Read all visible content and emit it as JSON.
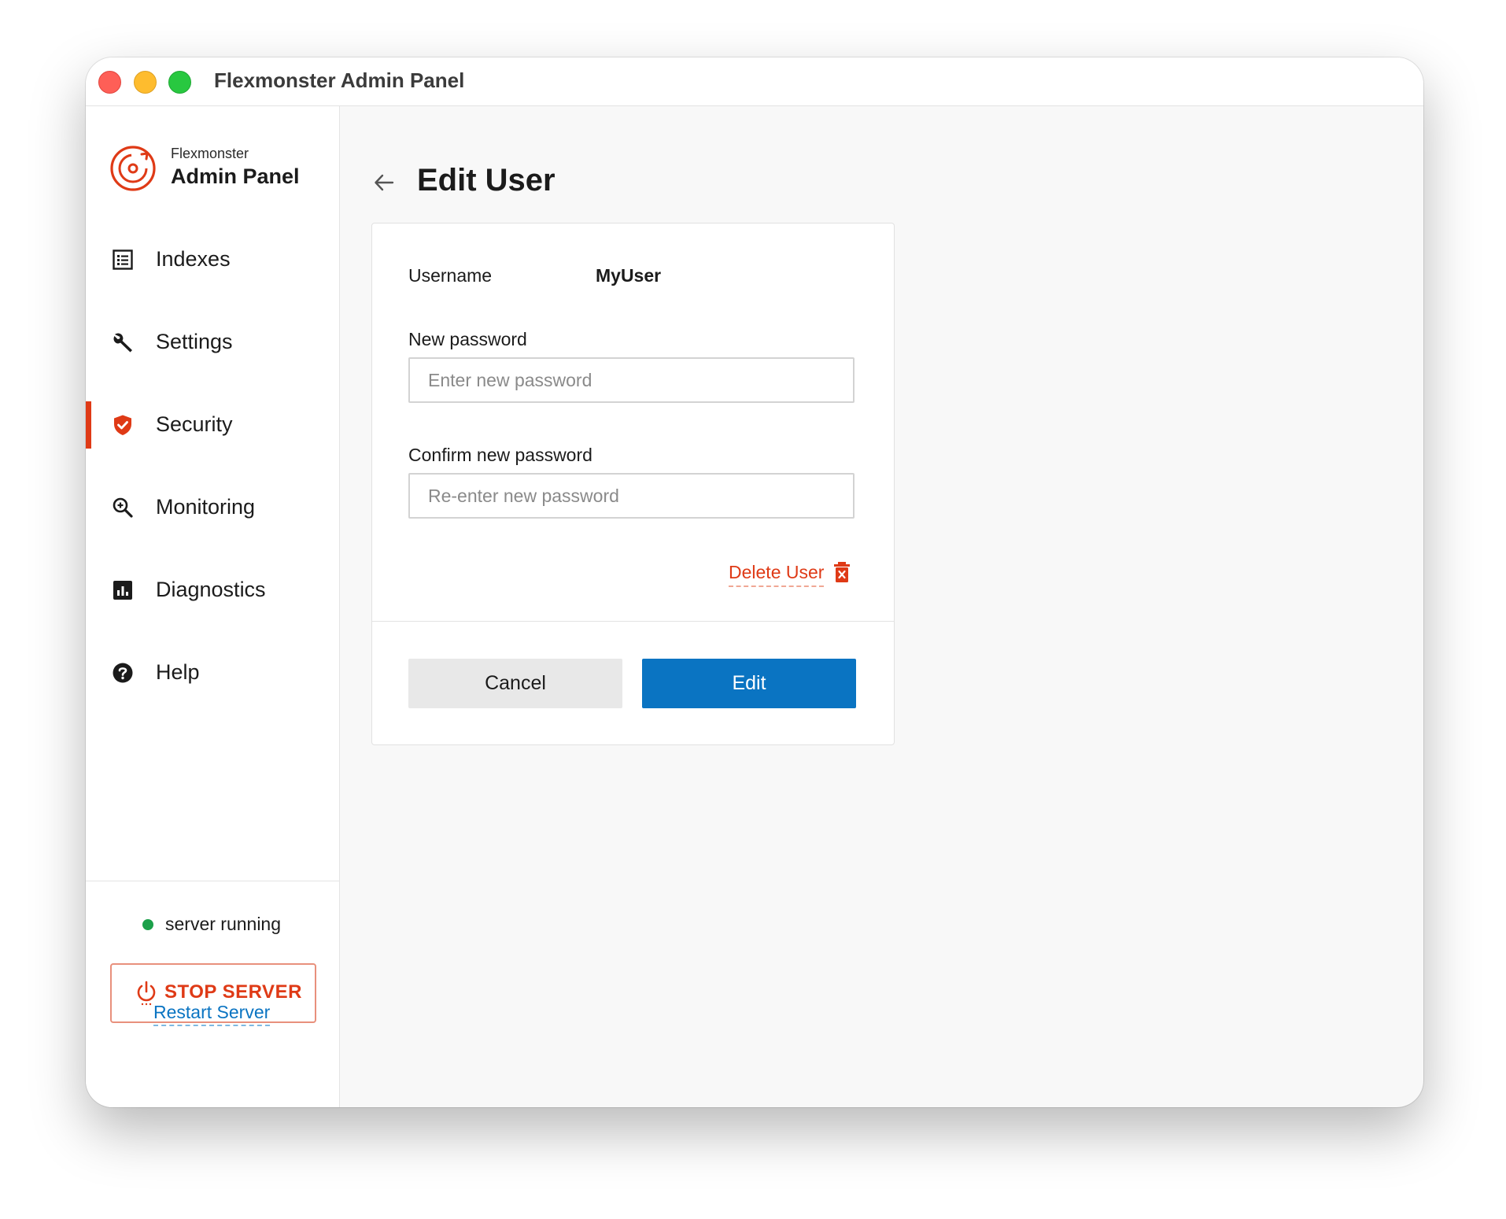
{
  "window": {
    "title": "Flexmonster Admin Panel"
  },
  "brand": {
    "small": "Flexmonster",
    "big": "Admin Panel"
  },
  "nav": {
    "items": [
      {
        "label": "Indexes",
        "icon": "list-icon",
        "active": false
      },
      {
        "label": "Settings",
        "icon": "wrench-icon",
        "active": false
      },
      {
        "label": "Security",
        "icon": "shield-check-icon",
        "active": true
      },
      {
        "label": "Monitoring",
        "icon": "magnifier-icon",
        "active": false
      },
      {
        "label": "Diagnostics",
        "icon": "bar-chart-icon",
        "active": false
      },
      {
        "label": "Help",
        "icon": "help-icon",
        "active": false
      }
    ]
  },
  "server": {
    "status_text": "server running",
    "stop_label": "STOP SERVER",
    "restart_label": "Restart Server"
  },
  "page": {
    "title": "Edit User"
  },
  "form": {
    "username_label": "Username",
    "username_value": "MyUser",
    "new_password_label": "New password",
    "new_password_placeholder": "Enter new password",
    "confirm_password_label": "Confirm new password",
    "confirm_password_placeholder": "Re-enter new password",
    "delete_label": "Delete User",
    "cancel_label": "Cancel",
    "edit_label": "Edit"
  },
  "colors": {
    "accent": "#df3a16",
    "primary": "#0a74c2",
    "status_ok": "#1ca04a"
  }
}
